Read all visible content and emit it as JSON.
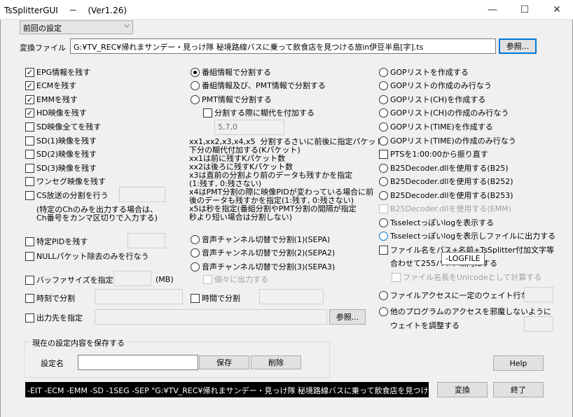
{
  "window": {
    "title": "TsSplitterGUI    －    (Ver1.26)",
    "minimize": "—",
    "maximize": "☐",
    "close": "✕"
  },
  "preset": {
    "value": "前回の設定"
  },
  "file": {
    "label": "変換ファイル",
    "value": "G:¥TV_REC¥帰れまサンデー・見っけ隊  秘境路線バスに乗って飲食店を見つける旅in伊豆半島[字].ts",
    "browse": "参照..."
  },
  "left": {
    "epg": "EPG情報を残す",
    "ecm": "ECMを残す",
    "emm": "EMMを残す",
    "hd": "HD映像を残す",
    "sd_all": "SD映像全てを残す",
    "sd1": "SD(1)映像を残す",
    "sd2": "SD(2)映像を残す",
    "sd3": "SD(3)映像を残す",
    "oneseg": "ワンセグ映像を残す",
    "cs": "CS放送の分割を行う",
    "cs_note": "(特定のChのみを出力する場合は、\nCh番号をカンマ区切りで入力する)",
    "pid": "特定PIDを残す",
    "null": "NULLパケット除去のみを行なう",
    "buf": "バッファサイズを指定",
    "mb": "(MB)",
    "time": "時刻で分割",
    "out": "出力先を指定",
    "out_browse": "参照..."
  },
  "middle": {
    "r1": "番組情報で分割する",
    "r2": "番組情報及び、PMT情報で分割する",
    "r3": "PMT情報で分割する",
    "margin": "分割する際に糊代を付加する",
    "margin_val": "5,7,0",
    "note": "xx1,xx2,x3,x4,x5  分割するさいに前後に指定パケット\n下分の糊代付加する(Kパケット)\nxx1は前に残すKパケット数\nxx2は後ろに残すKパケット数\nx3は直前の分割より前のデータも残すかを指定\n(1:残す, 0:残さない)\nx4はPMT分割の際に映像PIDが変わっている場合に前\n後のデータも残すかを指定(1:残す, 0:残さない)\nx5は秒を指定(番組分割やPMT分割の間隔が指定\n秒より短い場合は分割しない)",
    "a1": "音声チャンネル切替で分割(1)(SEPA)",
    "a2": "音声チャンネル切替で分割(2)(SEPA2)",
    "a3": "音声チャンネル切替で分割(3)(SEPA3)",
    "indiv": "個々に出力する",
    "timediv": "時間で分割"
  },
  "right": {
    "g1": "GOPリストを作成する",
    "g2": "GOPリストの作成のみ行なう",
    "g3": "GOPリスト(CH)を作成する",
    "g4": "GOPリスト(CH)の作成のみ行なう",
    "g5": "GOPリスト(TIME)を作成する",
    "g6": "GOPリスト(TIME)の作成のみ行なう",
    "pts": "PTSを1:00:00から振り直す",
    "b25": "B25Decoder.dllを使用する(B25)",
    "b252": "B25Decoder.dllを使用する(B252)",
    "b253": "B25Decoder.dllを使用する(B253)",
    "emm": "B25Decoder.dllを使用する(EMM)",
    "log1": "Tsselectっぽいlogを表示する",
    "log2": "Tsselectっぽいlogを表示しファイルに出力する",
    "fn1": "ファイル名をパス+名前+TsSplitter付加文字等",
    "fn2": "合わせて255バイト以内にする",
    "uni": "ファイル名長をUnicodeとして計算する",
    "wait": "ファイルアクセスに一定のウェイト行なう",
    "other1": "他のプログラムのアクセスを邪魔しないように",
    "other2": "ウェイトを調整する",
    "tooltip": "-LOGFILE"
  },
  "save": {
    "legend": "現在の設定内容を保存する",
    "name": "設定名",
    "save": "保存",
    "del": "削除"
  },
  "help": "Help",
  "cmd": "-EIT -ECM -EMM -SD -1SEG -SEP \"G:¥TV_REC¥帰れまサンデー・見っけ隊  秘境路線バスに乗って飲食店を見つける旅in伊",
  "convert": "変換",
  "exit": "終了"
}
